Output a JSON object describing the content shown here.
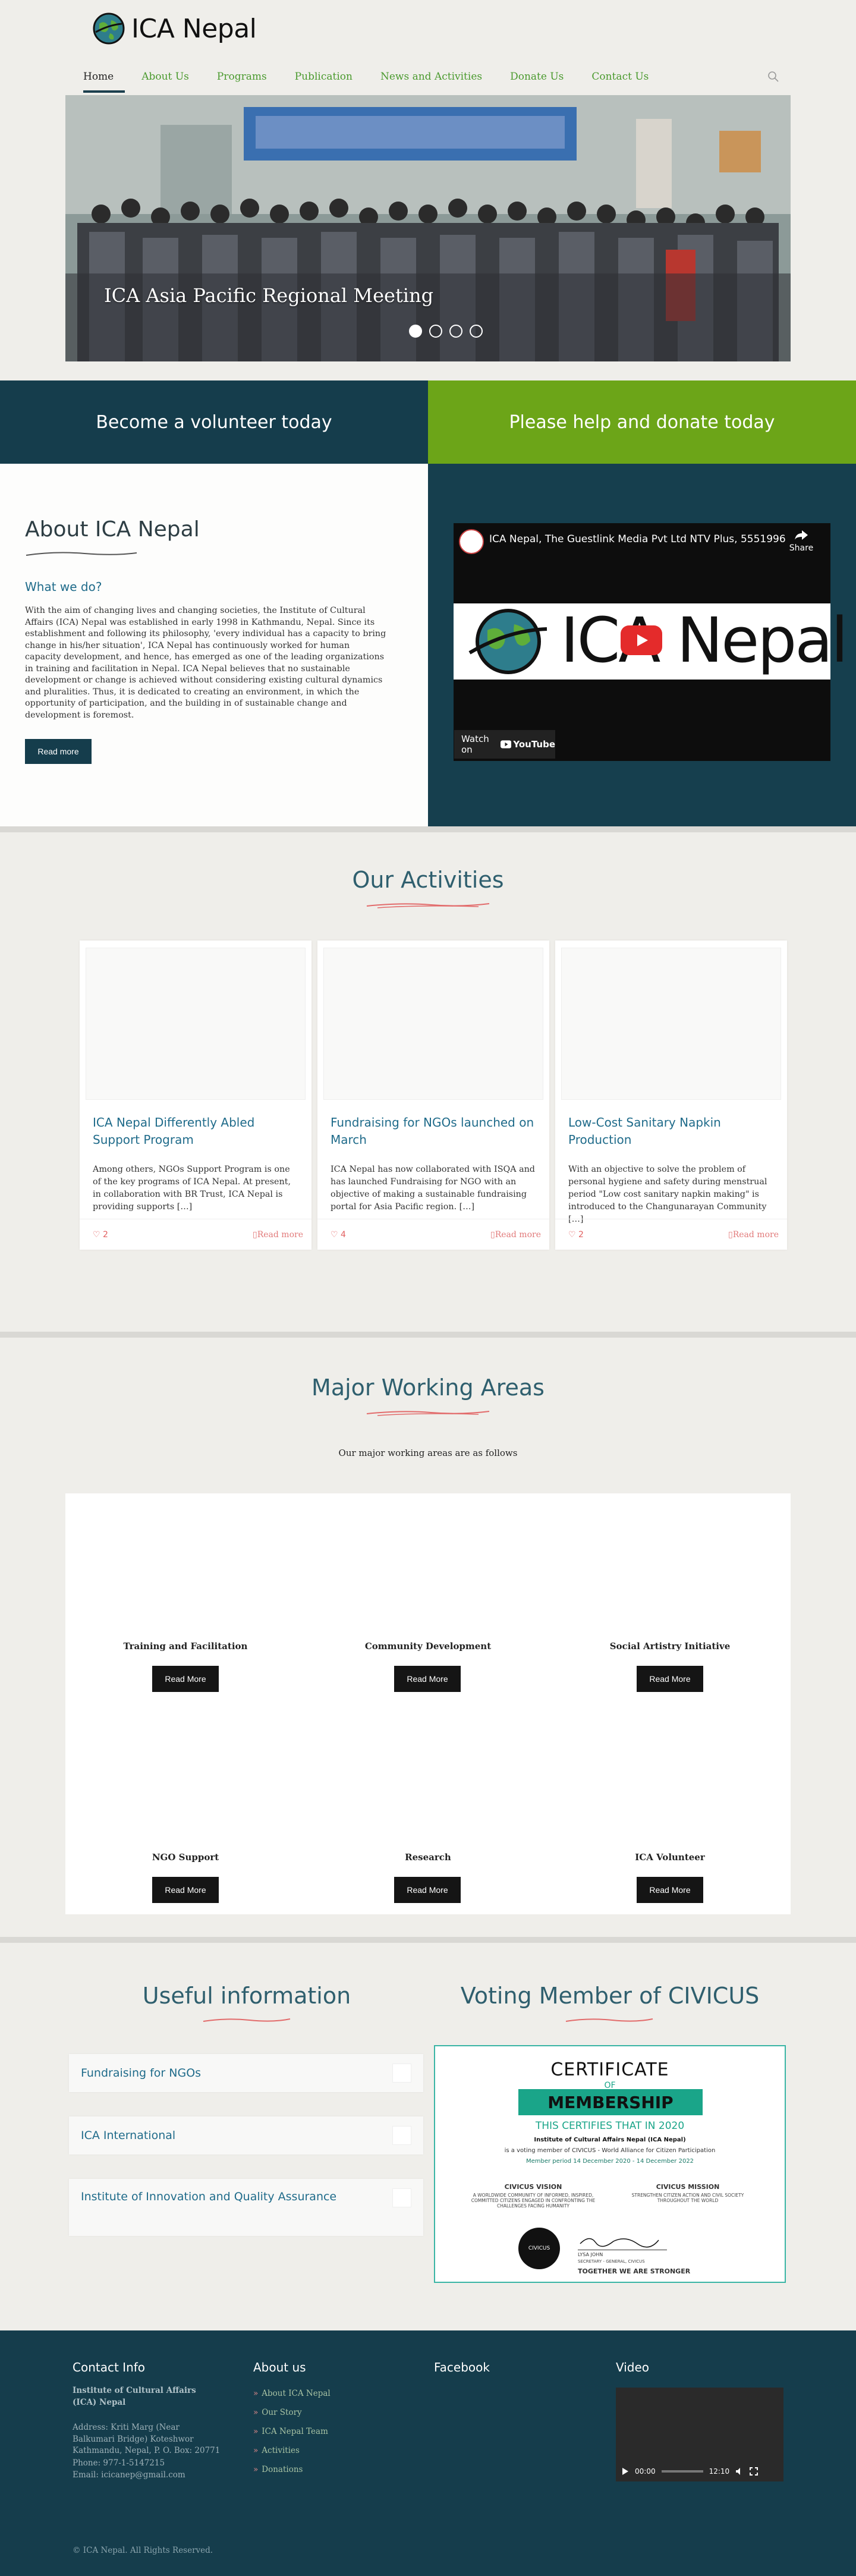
{
  "header": {
    "logo_text": "ICA Nepal",
    "nav": [
      {
        "label": "Home",
        "active": true
      },
      {
        "label": "About Us"
      },
      {
        "label": "Programs"
      },
      {
        "label": "Publication"
      },
      {
        "label": "News and Activities"
      },
      {
        "label": "Donate Us"
      },
      {
        "label": "Contact Us"
      }
    ],
    "search_icon": "search-icon"
  },
  "slider": {
    "caption": "ICA Asia Pacific Regional Meeting",
    "dots": 4,
    "active_dot": 1
  },
  "cta": {
    "volunteer": "Become a volunteer today",
    "donate": "Please help and donate today"
  },
  "about": {
    "title": "About ICA Nepal",
    "subtitle": "What we do?",
    "body": "With the aim of changing lives and changing societies, the Institute of Cultural Affairs (ICA) Nepal was established in early 1998 in Kathmandu, Nepal. Since its establishment and following its philosophy, 'every individual has a capacity to bring change in his/her situation', ICA Nepal has continuously worked for human capacity development, and hence, has emerged as one of the leading organizations in training and facilitation in Nepal. ICA Nepal believes that no sustainable development or change is achieved without considering existing cultural dynamics and pluralities. Thus, it is dedicated to creating an environment, in which the opportunity of participation, and the building in of sustainable change and development is foremost.",
    "button": "Read more"
  },
  "video": {
    "title": "ICA Nepal, The Guestlink Media Pvt Ltd NTV Plus, 5551996",
    "share": "Share",
    "watch_on": "Watch on",
    "youtube": "YouTube",
    "logo_text": "ICA Nepal"
  },
  "activities": {
    "title": "Our Activities",
    "cards": [
      {
        "title": "ICA Nepal Differently Abled Support Program",
        "excerpt": "Among others, NGOs Support Program is one of the key programs of ICA Nepal. At present, in collaboration with BR Trust, ICA Nepal is providing supports […]",
        "likes": "2",
        "more": "Read more"
      },
      {
        "title": "Fundraising for NGOs launched on March",
        "excerpt": "ICA Nepal has now collaborated with ISQA and has launched Fundraising for NGO with an objective of making a sustainable fundraising portal for Asia Pacific region. […]",
        "likes": "4",
        "more": "Read more"
      },
      {
        "title": "Low-Cost Sanitary Napkin Production",
        "excerpt": "With an objective to solve the problem of personal hygiene and safety during menstrual period \"Low cost sanitary napkin making\" is introduced to the Changunarayan Community […]",
        "likes": "2",
        "more": "Read more"
      }
    ]
  },
  "working_areas": {
    "title": "Major Working Areas",
    "description": "Our major working areas are as follows",
    "items": [
      {
        "label": "Training and Facilitation",
        "button": "Read More"
      },
      {
        "label": "Community Development",
        "button": "Read More"
      },
      {
        "label": "Social Artistry Initiative",
        "button": "Read More"
      },
      {
        "label": "NGO Support",
        "button": "Read More"
      },
      {
        "label": "Research",
        "button": "Read More"
      },
      {
        "label": "ICA Volunteer",
        "button": "Read More"
      }
    ]
  },
  "useful": {
    "title": "Useful information",
    "items": [
      {
        "label": "Fundraising for NGOs"
      },
      {
        "label": "ICA International"
      },
      {
        "label": "Institute of Innovation and Quality Assurance"
      }
    ]
  },
  "civicus": {
    "title": "Voting Member of CIVICUS",
    "cert": {
      "heading": "CERTIFICATE",
      "of": "OF",
      "membership": "MEMBERSHIP",
      "certifies": "THIS CERTIFIES THAT IN 2020",
      "org": "Institute of Cultural Affairs Nepal (ICA Nepal)",
      "line": "is a voting member of CIVICUS - World Alliance for Citizen Participation",
      "period": "Member period 14 December 2020 - 14 December 2022",
      "vision_h": "CIVICUS VISION",
      "mission_h": "CIVICUS MISSION",
      "vision": "A WORLDWIDE COMMUNITY OF INFORMED, INSPIRED, COMMITTED CITIZENS ENGAGED IN CONFRONTING THE CHALLENGES FACING HUMANITY",
      "mission": "STRENGTHEN CITIZEN ACTION AND CIVIL SOCIETY THROUGHOUT THE WORLD",
      "signer": "LYSA JOHN",
      "signer_title": "SECRETARY - GENERAL, CIVICUS",
      "slogan": "TOGETHER WE ARE STRONGER",
      "badge": "CIVICUS"
    }
  },
  "footer": {
    "contact_head": "Contact Info",
    "org_name": "Institute of Cultural Affairs (ICA) Nepal",
    "address": "Address: Kriti Marg (Near Balkumari Bridge) Koteshwor Kathmandu, Nepal, P. O. Box: 20771",
    "phone": "Phone: 977-1-5147215",
    "email": "Email: icicanep@gmail.com",
    "about_head": "About us",
    "about_links": [
      "About ICA Nepal",
      "Our Story",
      "ICA Nepal Team",
      "Activities",
      "Donations"
    ],
    "facebook_head": "Facebook",
    "video_head": "Video",
    "video_time": "00:00",
    "video_duration": "12:10",
    "copyright": "© ICA Nepal. All Rights Reserved."
  }
}
